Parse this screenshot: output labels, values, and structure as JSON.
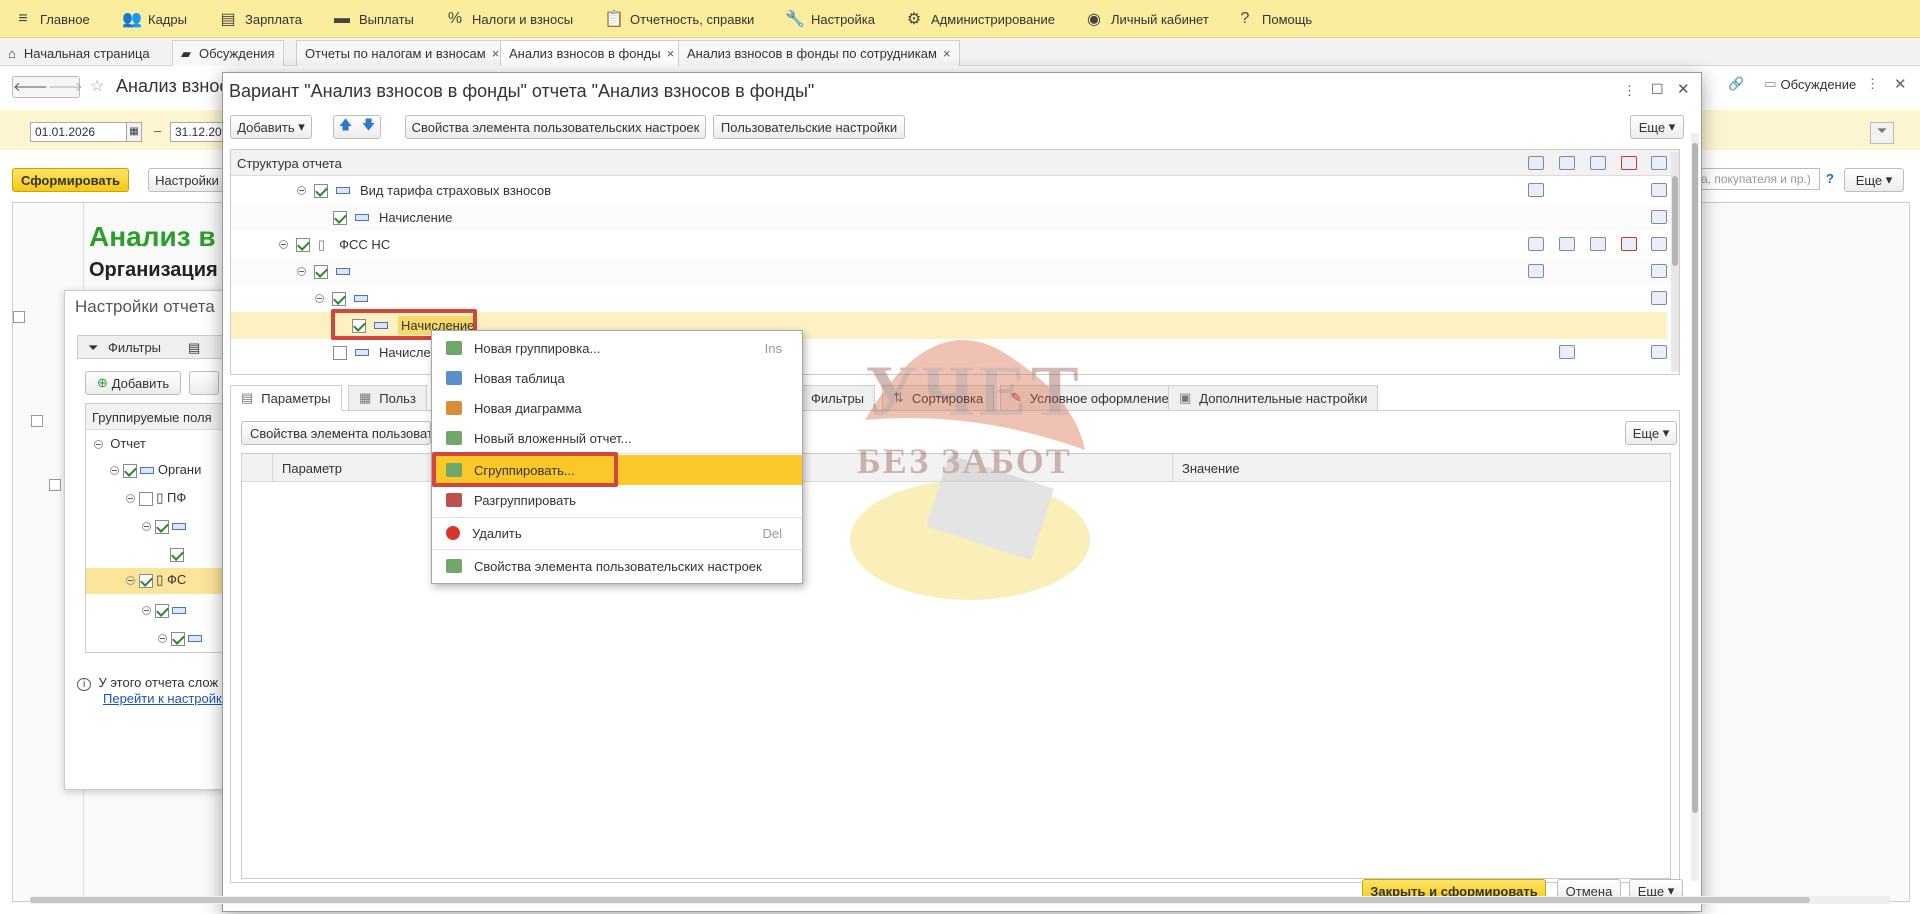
{
  "topmenu": [
    {
      "icon": "≡",
      "label": "Главное",
      "name": "menu-main"
    },
    {
      "icon": "👥",
      "label": "Кадры",
      "name": "menu-staff"
    },
    {
      "icon": "▤",
      "label": "Зарплата",
      "name": "menu-salary"
    },
    {
      "icon": "▬",
      "label": "Выплаты",
      "name": "menu-payments"
    },
    {
      "icon": "%",
      "label": "Налоги и взносы",
      "name": "menu-taxes"
    },
    {
      "icon": "📋",
      "label": "Отчетность, справки",
      "name": "menu-reports"
    },
    {
      "icon": "🔧",
      "label": "Настройка",
      "name": "menu-setup"
    },
    {
      "icon": "⚙",
      "label": "Администрирование",
      "name": "menu-admin"
    },
    {
      "icon": "◉",
      "label": "Личный кабинет",
      "name": "menu-cabinet"
    },
    {
      "icon": "?",
      "label": "Помощь",
      "name": "menu-help"
    }
  ],
  "tabs": [
    {
      "label": "Начальная страница",
      "close": ""
    },
    {
      "label": "Обсуждения",
      "close": ""
    },
    {
      "label": "Отчеты по налогам и взносам",
      "close": "×"
    },
    {
      "label": "Анализ взносов в фонды",
      "close": "×"
    },
    {
      "label": "Анализ взносов в фонды по сотрудникам",
      "close": "×"
    }
  ],
  "background": {
    "title": "Анализ взнос",
    "date_from": "01.01.2026",
    "date_to": "31.12.20",
    "form_button": "Сформировать",
    "settings_button": "Настройки",
    "report_heading": "Анализ в",
    "org_heading": "Организация",
    "discussion": "Обсуждение",
    "search_placeholder": "а, покупателя и пр.)",
    "more": "Еще",
    "settings_title": "Настройки отчета",
    "filters_tab": "Фильтры",
    "add": "Добавить",
    "grouping_fields": "Группируемые поля",
    "tree": [
      "Отчет",
      "Органи",
      "ПФ",
      "",
      "",
      "ФС",
      "",
      ""
    ],
    "info": "У этого отчета слож",
    "info_link": "Перейти к настройке"
  },
  "dialog": {
    "title": "Вариант \"Анализ взносов в фонды\" отчета \"Анализ взносов в фонды\"",
    "toolbar": {
      "add": "Добавить",
      "props": "Свойства элемента пользовательских настроек",
      "user_settings": "Пользовательские настройки",
      "more": "Еще"
    },
    "structure_header": "Структура отчета",
    "rows": [
      {
        "label": "Вид тарифа страховых взносов",
        "checked": true,
        "indent": 1,
        "type": "field"
      },
      {
        "label": "Начисление",
        "checked": true,
        "indent": 2,
        "type": "field"
      },
      {
        "label": "ФСС НС",
        "checked": true,
        "indent": 0,
        "type": "doc"
      },
      {
        "label": "",
        "checked": true,
        "indent": 1,
        "type": "field"
      },
      {
        "label": "",
        "checked": true,
        "indent": 2,
        "type": "field"
      },
      {
        "label": "Начисление",
        "checked": true,
        "indent": 3,
        "type": "field",
        "selected": true
      },
      {
        "label": "Начисле",
        "checked": false,
        "indent": 2,
        "type": "field"
      }
    ],
    "subtabs": [
      "Параметры",
      "Польз",
      "Фильтры",
      "Сортировка",
      "Условное оформление",
      "Дополнительные настройки"
    ],
    "params": {
      "props_button": "Свойства элемента пользовате",
      "more": "Еще",
      "col_param": "Параметр",
      "col_value": "Значение"
    },
    "footer": {
      "close_form": "Закрыть и сформировать",
      "cancel": "Отмена",
      "more": "Еще"
    }
  },
  "context_menu": [
    {
      "label": "Новая группировка...",
      "shortcut": "Ins",
      "color": "#6fa86a"
    },
    {
      "label": "Новая таблица",
      "shortcut": "",
      "color": "#5b8fc9"
    },
    {
      "label": "Новая диаграмма",
      "shortcut": "",
      "color": "#d98d3a"
    },
    {
      "label": "Новый вложенный отчет...",
      "shortcut": "",
      "color": "#6fa86a"
    },
    {
      "label": "Сгруппировать...",
      "shortcut": "",
      "color": "#6fa86a",
      "highlight": true
    },
    {
      "label": "Разгруппировать",
      "shortcut": "",
      "color": "#c0504d"
    },
    {
      "label": "Удалить",
      "shortcut": "Del",
      "color": "#d9362b"
    },
    {
      "label": "Свойства элемента пользовательских настроек",
      "shortcut": "",
      "color": "#6fa86a"
    }
  ],
  "watermark": {
    "line1": "УЧЕТ",
    "line2": "БЕЗ ЗАБОТ"
  }
}
